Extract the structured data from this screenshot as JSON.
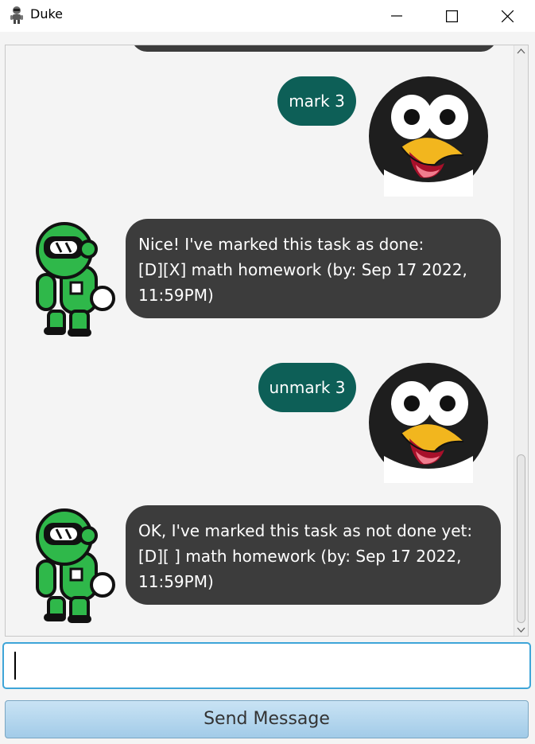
{
  "window": {
    "title": "Duke",
    "controls": [
      "minimize",
      "maximize",
      "close"
    ]
  },
  "colors": {
    "user_bubble": "#0d5f57",
    "duke_bubble": "#3c3c3c",
    "input_border": "#3ea5d8",
    "button_top": "#c9e3f4",
    "button_bottom": "#a2cbe8"
  },
  "messages": [
    {
      "from": "user",
      "text": "mark 3",
      "avatar": "penguin-avatar"
    },
    {
      "from": "duke",
      "lines": [
        "Nice! I've marked this task as done:",
        "[D][X] math homework (by: Sep 17 2022,",
        "11:59PM)"
      ],
      "avatar": "robot-avatar"
    },
    {
      "from": "user",
      "text": "unmark 3",
      "avatar": "penguin-avatar"
    },
    {
      "from": "duke",
      "lines": [
        "OK, I've marked this task as not done yet:",
        "[D][ ] math homework (by: Sep 17 2022,",
        "11:59PM)"
      ],
      "avatar": "robot-avatar"
    }
  ],
  "input": {
    "value": "",
    "placeholder": ""
  },
  "send_button": {
    "label": "Send Message"
  }
}
